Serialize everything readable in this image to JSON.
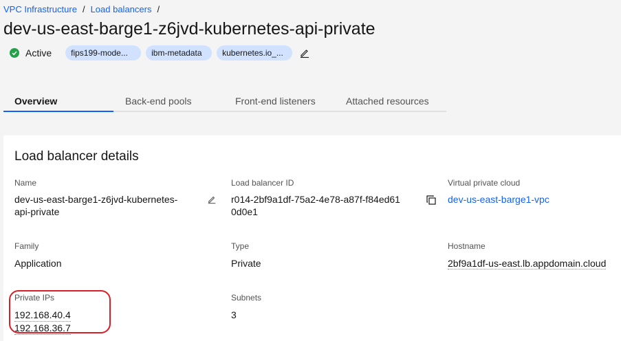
{
  "breadcrumb": {
    "items": [
      "VPC Infrastructure",
      "Load balancers"
    ],
    "separator": "/"
  },
  "page": {
    "title": "dev-us-east-barge1-z6jvd-kubernetes-api-private",
    "status": "Active",
    "status_color": "#24a148",
    "tags": [
      "fips199-mode...",
      "ibm-metadata",
      "kubernetes.io_..."
    ]
  },
  "tabs": [
    "Overview",
    "Back-end pools",
    "Front-end listeners",
    "Attached resources"
  ],
  "details": {
    "title": "Load balancer details",
    "name_label": "Name",
    "name_line1": "dev-us-east-barge1-z6jvd-kubernetes-",
    "name_line2": "api-private",
    "id_label": "Load balancer ID",
    "id_line1": "r014-2bf9a1df-75a2-4e78-a87f-f84ed61",
    "id_line2": "0d0e1",
    "vpc_label": "Virtual private cloud",
    "vpc_value": "dev-us-east-barge1-vpc",
    "family_label": "Family",
    "family_value": "Application",
    "type_label": "Type",
    "type_value": "Private",
    "hostname_label": "Hostname",
    "hostname_value": "2bf9a1df-us-east.lb.appdomain.cloud",
    "private_ips_label": "Private IPs",
    "private_ips": [
      "192.168.40.4",
      "192.168.36.7"
    ],
    "subnets_label": "Subnets",
    "subnets_value": "3"
  },
  "colors": {
    "link": "#0f62fe",
    "tag_bg": "#d0e2ff",
    "highlight": "#da1e28"
  }
}
